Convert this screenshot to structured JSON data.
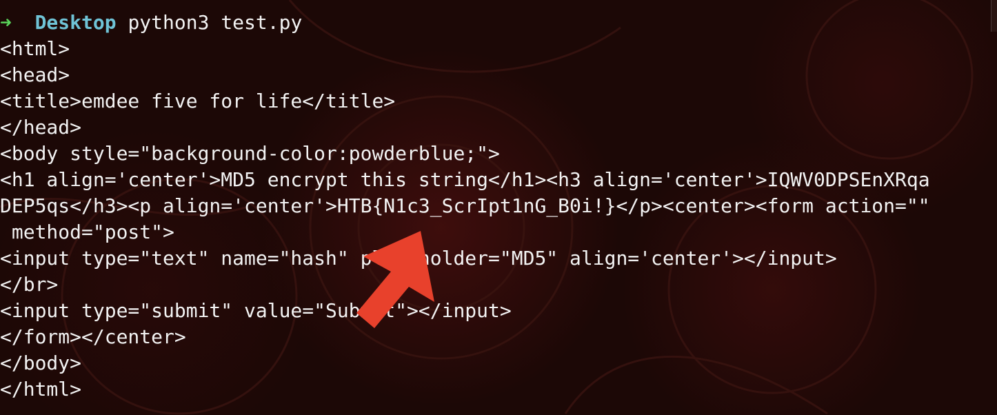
{
  "prompt": {
    "arrow": "➜",
    "directory": "Desktop",
    "command": "python3 test.py"
  },
  "output_lines": [
    "<html>",
    "<head>",
    "<title>emdee five for life</title>",
    "</head>",
    "<body style=\"background-color:powderblue;\">",
    "<h1 align='center'>MD5 encrypt this string</h1><h3 align='center'>IQWV0DPSEnXRqa",
    "DEP5qs</h3><p align='center'>HTB{N1c3_ScrIpt1nG_B0i!}</p><center><form action=\"\"",
    " method=\"post\">",
    "<input type=\"text\" name=\"hash\" placeholder=\"MD5\" align='center'></input>",
    "</br>",
    "<input type=\"submit\" value=\"Submit\"></input>",
    "</form></center>",
    "</body>",
    "</html>"
  ],
  "annotation": {
    "icon": "red-pointer-arrow-icon",
    "color": "#e8412c"
  },
  "colors": {
    "background": "#1c0806",
    "text": "#f3f3f3",
    "prompt_arrow": "#5ad45a",
    "prompt_dir": "#6fc3d6"
  }
}
